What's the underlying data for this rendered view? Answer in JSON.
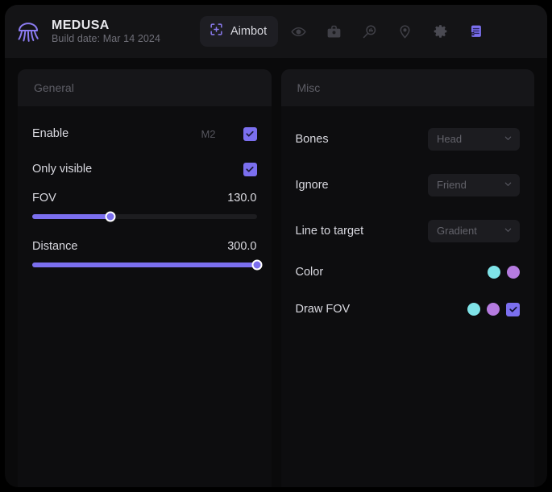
{
  "app": {
    "title": "MEDUSA",
    "build": "Build date: Mar 14 2024",
    "logo_icon": "jellyfish-icon",
    "accent": "#7b6fef"
  },
  "header": {
    "active_tab": {
      "label": "Aimbot",
      "icon": "crosshair-plus-icon"
    },
    "icons": [
      {
        "name": "eye-icon",
        "title": "Visuals"
      },
      {
        "name": "briefcase-icon",
        "title": "Items"
      },
      {
        "name": "search-icon",
        "title": "Search"
      },
      {
        "name": "map-pin-icon",
        "title": "Radar"
      },
      {
        "name": "gear-icon",
        "title": "Settings"
      },
      {
        "name": "config-icon",
        "title": "Config"
      }
    ]
  },
  "panels": {
    "general": {
      "title": "General",
      "enable": {
        "label": "Enable",
        "keybind": "M2",
        "checked": true
      },
      "only_visible": {
        "label": "Only visible",
        "checked": true
      },
      "fov": {
        "label": "FOV",
        "value": "130.0",
        "percent": 35
      },
      "distance": {
        "label": "Distance",
        "value": "300.0",
        "percent": 100
      }
    },
    "misc": {
      "title": "Misc",
      "bones": {
        "label": "Bones",
        "value": "Head"
      },
      "ignore": {
        "label": "Ignore",
        "value": "Friend"
      },
      "line_to_target": {
        "label": "Line to target",
        "value": "Gradient"
      },
      "color": {
        "label": "Color",
        "swatches": [
          "#7fe3e8",
          "#b57be0"
        ]
      },
      "draw_fov": {
        "label": "Draw FOV",
        "swatches": [
          "#7fe3e8",
          "#b57be0"
        ],
        "checked": true
      }
    }
  }
}
